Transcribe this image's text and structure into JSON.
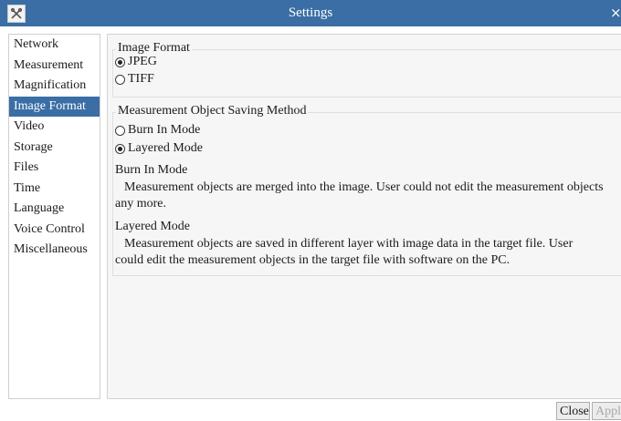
{
  "window": {
    "title": "Settings",
    "app_icon": "tools-icon",
    "close_glyph": "×"
  },
  "sidebar": {
    "items": [
      {
        "label": "Network",
        "active": false
      },
      {
        "label": "Measurement",
        "active": false
      },
      {
        "label": "Magnification",
        "active": false
      },
      {
        "label": "Image Format",
        "active": true
      },
      {
        "label": "Video",
        "active": false
      },
      {
        "label": "Storage",
        "active": false
      },
      {
        "label": "Files",
        "active": false
      },
      {
        "label": "Time",
        "active": false
      },
      {
        "label": "Language",
        "active": false
      },
      {
        "label": "Voice Control",
        "active": false
      },
      {
        "label": "Miscellaneous",
        "active": false
      }
    ]
  },
  "image_format": {
    "title": "Image Format",
    "options": [
      {
        "label": "JPEG",
        "selected": true
      },
      {
        "label": "TIFF",
        "selected": false
      }
    ]
  },
  "saving_method": {
    "title": "Measurement Object Saving Method",
    "options": [
      {
        "label": "Burn In Mode",
        "selected": false
      },
      {
        "label": "Layered Mode",
        "selected": true
      }
    ]
  },
  "descriptions": {
    "burn_in_title": "Burn In Mode",
    "burn_in_text": "Measurement objects are merged into the image. User could not edit the measurement objects any more.",
    "layered_title": "Layered Mode",
    "layered_text": "Measurement objects are saved in different layer with image data in the target file. User could edit the measurement objects in the target file with software on the PC."
  },
  "footer": {
    "close_label": "Close",
    "apply_label": "Apply"
  },
  "colors": {
    "titlebar": "#3a6ea5",
    "selection": "#3a6ea5",
    "panel": "#f6f6f6"
  }
}
